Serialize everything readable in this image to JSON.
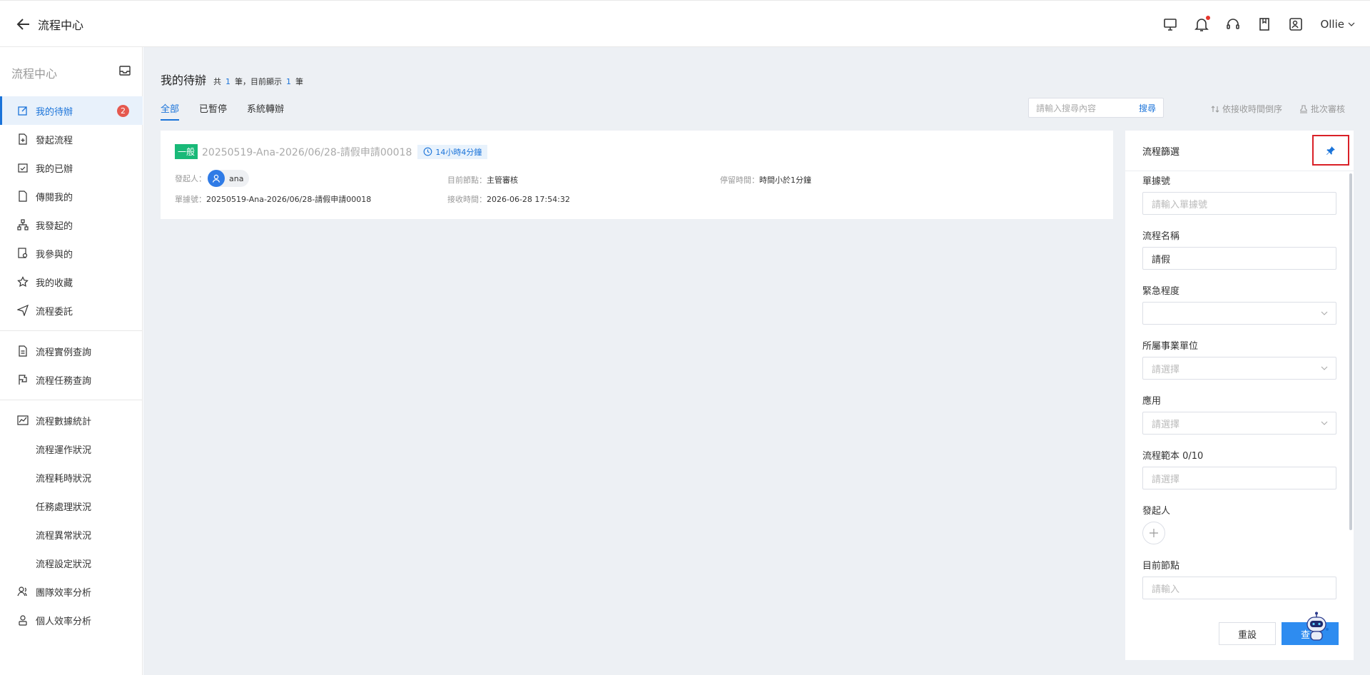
{
  "header": {
    "title": "流程中心",
    "user": "Ollie"
  },
  "sidebar": {
    "title": "流程中心",
    "items": [
      {
        "label": "我的待辦",
        "badge": "2"
      },
      {
        "label": "發起流程"
      },
      {
        "label": "我的已辦"
      },
      {
        "label": "傳閱我的"
      },
      {
        "label": "我發起的"
      },
      {
        "label": "我參與的"
      },
      {
        "label": "我的收藏"
      },
      {
        "label": "流程委託"
      },
      {
        "label": "流程實例查詢"
      },
      {
        "label": "流程任務查詢"
      },
      {
        "label": "流程數據統計"
      },
      {
        "label": "流程運作狀況"
      },
      {
        "label": "流程耗時狀況"
      },
      {
        "label": "任務處理狀況"
      },
      {
        "label": "流程異常狀況"
      },
      {
        "label": "流程設定狀況"
      },
      {
        "label": "團隊效率分析"
      },
      {
        "label": "個人效率分析"
      }
    ]
  },
  "main": {
    "title": "我的待辦",
    "meta_prefix": "共",
    "total": "1",
    "meta_mid": "筆，目前顯示",
    "shown": "1",
    "meta_suffix": "筆",
    "tabs": [
      "全部",
      "已暫停",
      "系統轉辦"
    ],
    "search_placeholder": "請輸入搜尋內容",
    "search_button": "搜尋",
    "sort_label": "依接收時間倒序",
    "batch_label": "批次審核"
  },
  "card": {
    "tag": "一般",
    "name": "20250519-Ana-2026/06/28-請假申請00018",
    "duration": "14小時4分鐘",
    "initiator_label": "發起人：",
    "initiator": "ana",
    "node_label": "目前節點：",
    "node": "主管審核",
    "stay_label": "停留時間：",
    "stay": "時間小於1分鐘",
    "doc_label": "單據號：",
    "doc": "20250519-Ana-2026/06/28-請假申請00018",
    "recv_label": "接收時間：",
    "recv": "2026-06-28 17:54:32"
  },
  "filter": {
    "title": "流程篩選",
    "fields": {
      "doc_label": "單據號",
      "doc_placeholder": "請輸入單據號",
      "name_label": "流程名稱",
      "name_value": "請假",
      "urgency_label": "緊急程度",
      "unit_label": "所屬事業單位",
      "unit_placeholder": "請選擇",
      "app_label": "應用",
      "app_placeholder": "請選擇",
      "template_label": "流程範本 0/10",
      "template_placeholder": "請選擇",
      "initiator_label": "發起人",
      "node_label": "目前節點",
      "node_placeholder": "請輸入"
    },
    "reset": "重設",
    "query": "查詢"
  },
  "colors": {
    "accent": "#1a73d9",
    "badge": "#e5594f",
    "tag": "#19b978",
    "highlight": "#d92027"
  }
}
